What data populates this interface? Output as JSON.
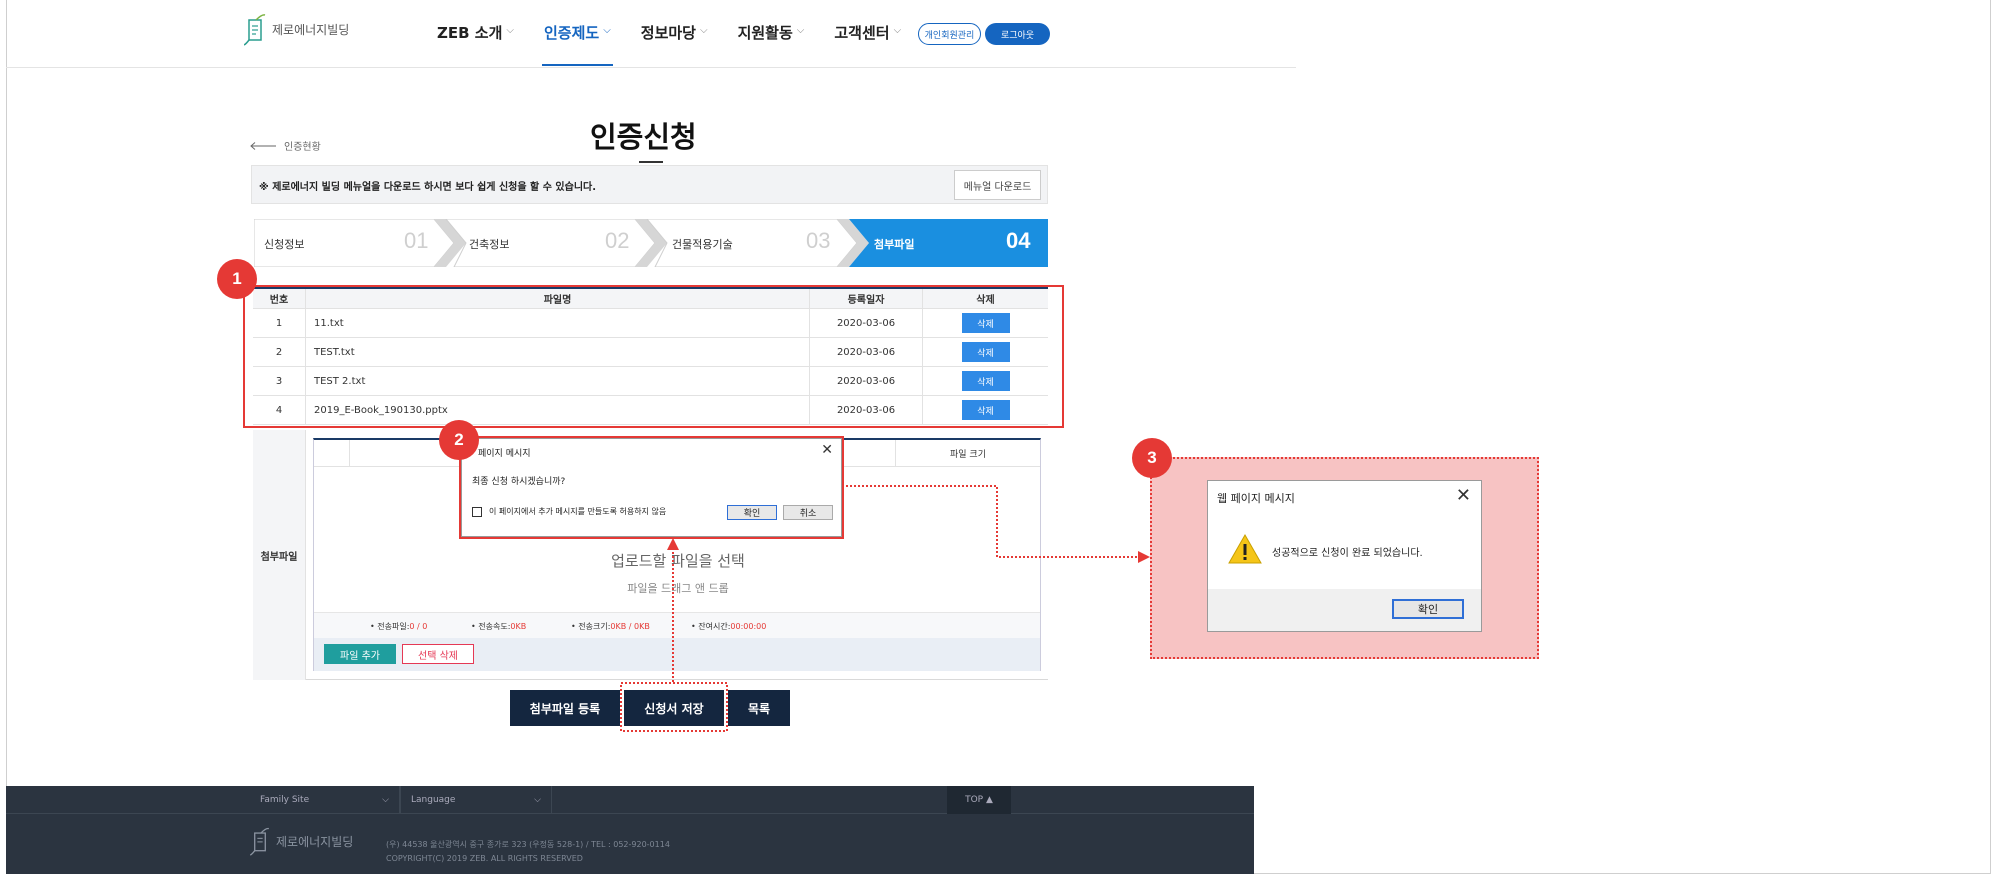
{
  "brand": {
    "name": "제로에너지빌딩"
  },
  "nav": {
    "items": [
      {
        "label": "ZEB 소개"
      },
      {
        "label": "인증제도"
      },
      {
        "label": "정보마당"
      },
      {
        "label": "지원활동"
      },
      {
        "label": "고객센터"
      }
    ],
    "active_index": 1,
    "member_btn": "개인회원관리",
    "logout_btn": "로그아웃"
  },
  "page": {
    "back_label": "인증현황",
    "title": "인증신청",
    "notice": "※ 제로에너지 빌딩 메뉴얼을 다운로드 하시면 보다 쉽게 신청을 할 수 있습니다.",
    "manual_btn": "메뉴얼 다운로드"
  },
  "steps": [
    {
      "label": "신청정보",
      "num": "01"
    },
    {
      "label": "건축정보",
      "num": "02"
    },
    {
      "label": "건물적용기술",
      "num": "03"
    },
    {
      "label": "첨부파일",
      "num": "04",
      "active": true
    }
  ],
  "file_table": {
    "headers": {
      "no": "번호",
      "name": "파일명",
      "date": "등록일자",
      "del": "삭제"
    },
    "rows": [
      {
        "no": "1",
        "name": "11.txt",
        "date": "2020-03-06",
        "del": "삭제"
      },
      {
        "no": "2",
        "name": "TEST.txt",
        "date": "2020-03-06",
        "del": "삭제"
      },
      {
        "no": "3",
        "name": "TEST 2.txt",
        "date": "2020-03-06",
        "del": "삭제"
      },
      {
        "no": "4",
        "name": "2019_E-Book_190130.pptx",
        "date": "2020-03-06",
        "del": "삭제"
      }
    ]
  },
  "attach": {
    "label": "첨부파일",
    "size_header": "파일 크기",
    "upload_title": "업로드할 파일을 선택",
    "upload_sub": "파일을 드래그 앤 드롭",
    "stats": [
      {
        "label": "• 전송파일:",
        "value": "0 / 0"
      },
      {
        "label": "• 전송속도:",
        "value": "0KB"
      },
      {
        "label": "• 전송크기:",
        "value": "0KB / 0KB"
      },
      {
        "label": "• 잔여시간:",
        "value": "00:00:00"
      }
    ],
    "add_btn": "파일 추가",
    "sel_del_btn": "선택 삭제"
  },
  "actions": {
    "register": "첨부파일 등록",
    "save": "신청서 저장",
    "list": "목록"
  },
  "footer": {
    "family_site": "Family Site",
    "language": "Language",
    "top": "TOP ▲",
    "logo": "제로에너지빌딩",
    "address": "(우) 44538 울산광역시 중구 종가로 323 (우정동 528-1) / TEL : 052-920-0114",
    "copyright": "COPYRIGHT(C) 2019 ZEB. ALL RIGHTS RESERVED"
  },
  "dialog_confirm": {
    "title": "페이지 메시지",
    "message": "최종 신청 하시겠습니까?",
    "checkbox_label": "이 페이지에서 추가 메시지를 만들도록 허용하지 않음",
    "ok": "확인",
    "cancel": "취소"
  },
  "dialog_done": {
    "title": "웹 페이지 메시지",
    "message": "성공적으로 신청이 완료 되었습니다.",
    "ok": "확인"
  },
  "markers": [
    "1",
    "2",
    "3"
  ],
  "colors": {
    "accent": "#1565c0",
    "step_active": "#1a8fe0",
    "delete_btn": "#2f8ae6",
    "annotation": "#e53935",
    "dark_btn": "#14263f"
  },
  "icons": {
    "close": "close-icon",
    "warning": "warning-icon",
    "chevron": "chevron-down-icon",
    "back": "arrow-left-icon"
  }
}
